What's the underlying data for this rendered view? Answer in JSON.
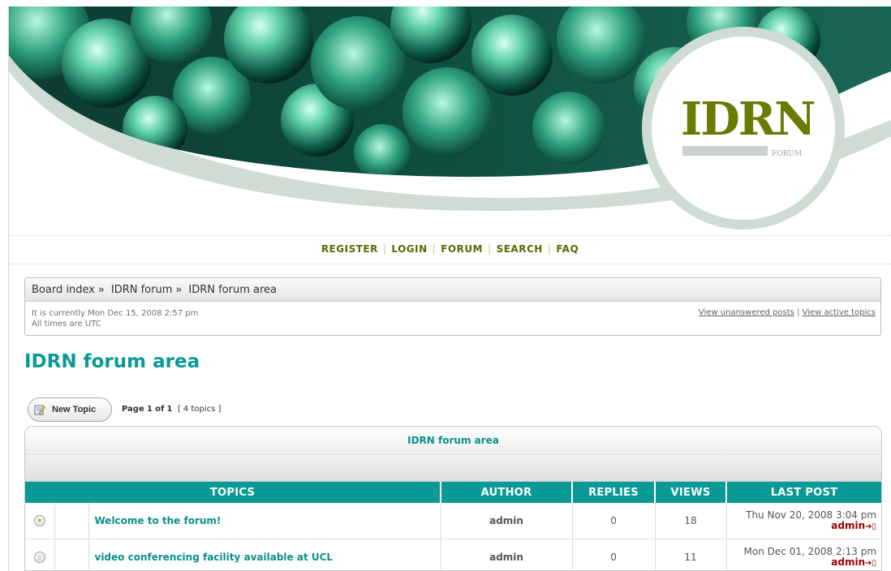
{
  "banner": {
    "logo_text": "IDRN",
    "logo_sub": "FORUM"
  },
  "nav": {
    "register": "REGISTER",
    "login": "LOGIN",
    "forum": "FORUM",
    "search": "SEARCH",
    "faq": "FAQ",
    "separator": "|"
  },
  "breadcrumb": {
    "items": [
      "Board index",
      "IDRN forum",
      "IDRN forum area"
    ],
    "separator": "»"
  },
  "info": {
    "current_time": "It is currently Mon Dec 15, 2008 2:57 pm",
    "timezone": "All times are UTC",
    "unanswered": "View unanswered posts",
    "link_sep": "|",
    "active": "View active topics"
  },
  "forum_title": "IDRN forum area",
  "toolbar": {
    "new_topic": "New Topic",
    "page_label": "Page",
    "page_current": "1",
    "page_of": "of",
    "page_total": "1",
    "topics_count": "[ 4 topics ]"
  },
  "table": {
    "caption": "IDRN forum area",
    "columns": [
      "TOPICS",
      "AUTHOR",
      "REPLIES",
      "VIEWS",
      "LAST POST"
    ],
    "rows": [
      {
        "icon": "announcement-icon",
        "title": "Welcome to the forum!",
        "author": "admin",
        "replies": "0",
        "views": "18",
        "last_date": "Thu Nov 20, 2008 3:04 pm",
        "last_author": "admin"
      },
      {
        "icon": "topic-read-icon",
        "title": "video conferencing facility available at UCL",
        "author": "admin",
        "replies": "0",
        "views": "11",
        "last_date": "Mon Dec 01, 2008 2:13 pm",
        "last_author": "admin"
      }
    ],
    "goto_glyph": "➔▯"
  },
  "colors": {
    "accent": "#0a9a96",
    "nav_olive": "#5a6a00",
    "logo_olive": "#6b7a00",
    "author_red": "#a00000"
  }
}
